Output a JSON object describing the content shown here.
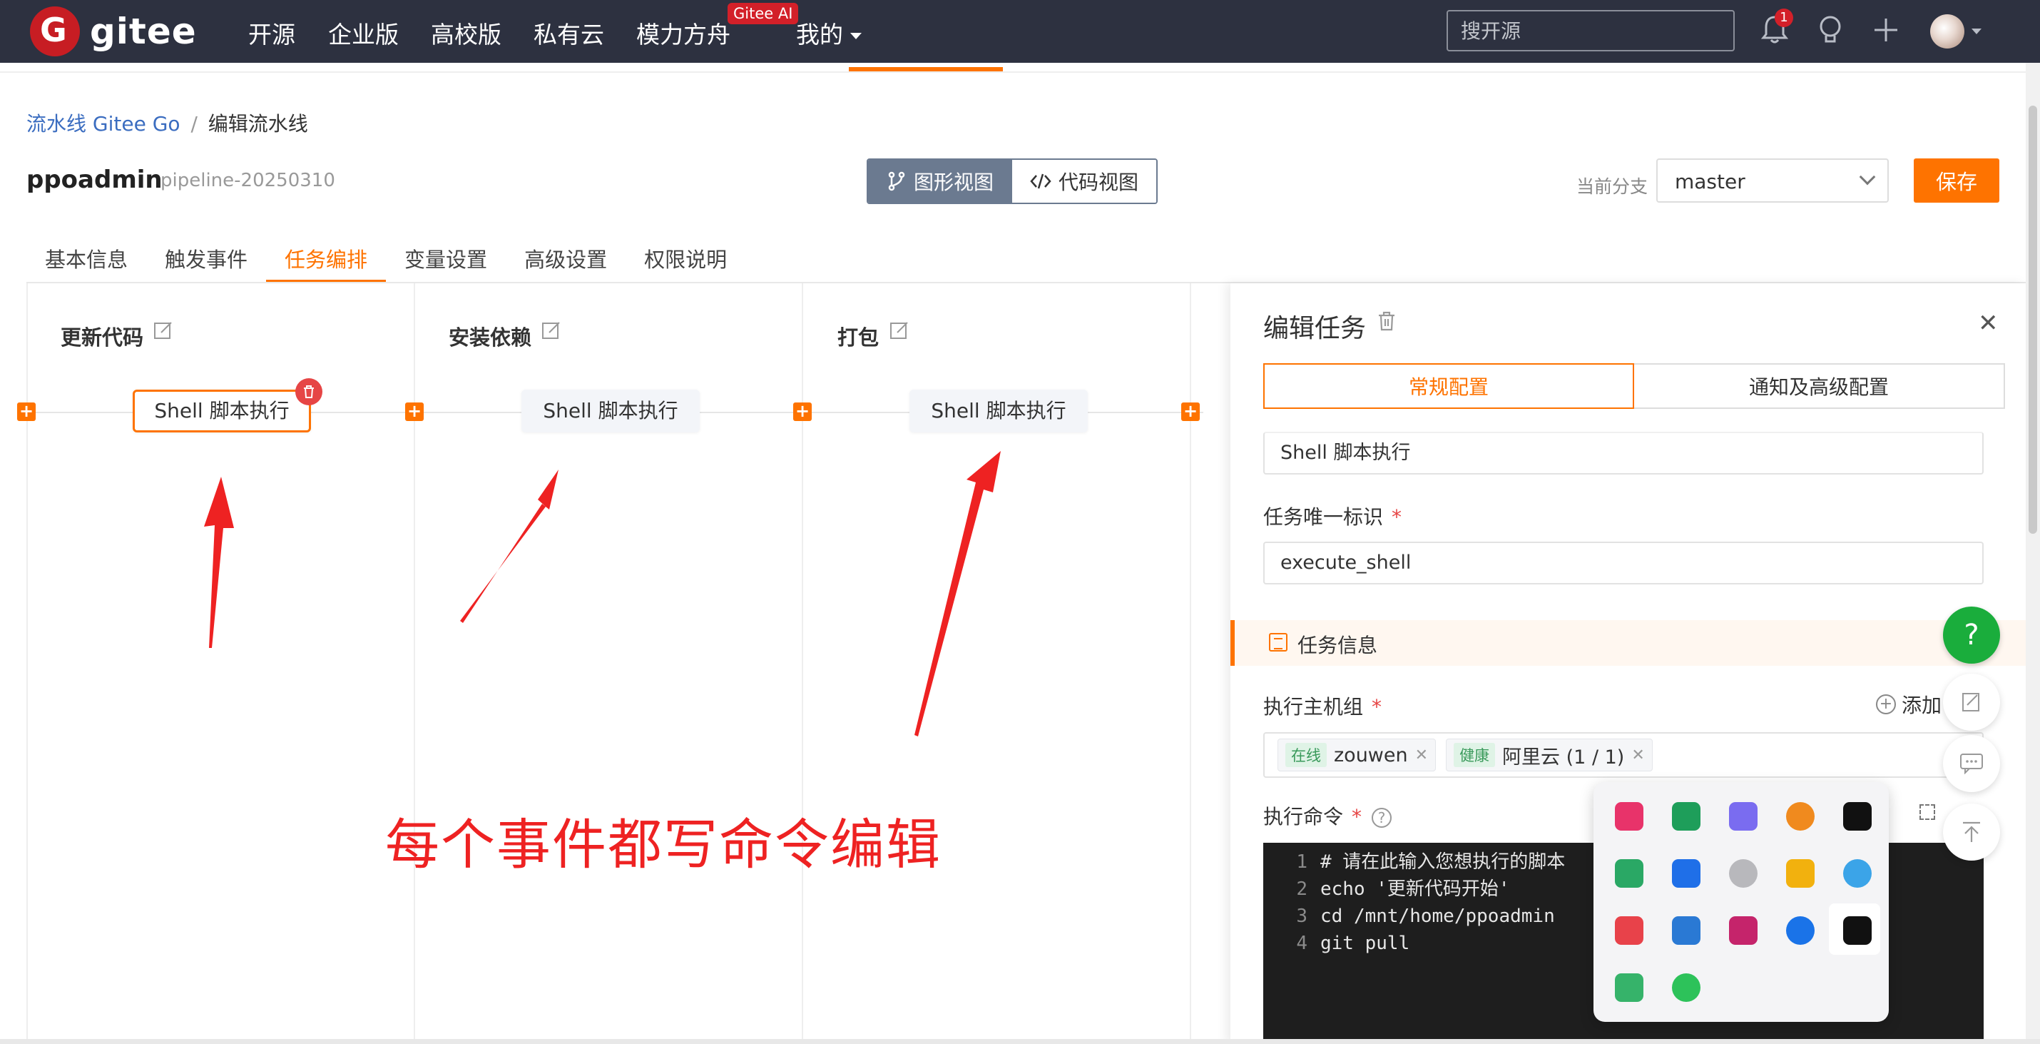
{
  "nav": {
    "brand": "gitee",
    "items": [
      "开源",
      "企业版",
      "高校版",
      "私有云",
      "模力方舟",
      "我的"
    ],
    "ai_badge": "Gitee AI",
    "search_placeholder": "搜开源",
    "notification_count": "1"
  },
  "breadcrumb": {
    "parent": "流水线 Gitee Go",
    "separator": "/",
    "current": "编辑流水线"
  },
  "header": {
    "project": "ppoadmin",
    "pipeline": "pipeline-20250310",
    "view_graph": "图形视图",
    "view_code": "代码视图",
    "branch_label": "当前分支",
    "branch_value": "master",
    "save": "保存"
  },
  "tabs": [
    "基本信息",
    "触发事件",
    "任务编排",
    "变量设置",
    "高级设置",
    "权限说明"
  ],
  "active_tab": "任务编排",
  "stages": [
    {
      "title": "更新代码",
      "job": "Shell 脚本执行"
    },
    {
      "title": "安装依赖",
      "job": "Shell 脚本执行"
    },
    {
      "title": "打包",
      "job": "Shell 脚本执行"
    }
  ],
  "annotation": "每个事件都写命令编辑",
  "drawer": {
    "title": "编辑任务",
    "tab_general": "常规配置",
    "tab_advanced": "通知及高级配置",
    "task_name_value": "Shell 脚本执行",
    "task_id_label": "任务唯一标识",
    "task_id_value": "execute_shell",
    "section_title": "任务信息",
    "host_group_label": "执行主机组",
    "add_label": "添加",
    "hosts": [
      {
        "status": "在线",
        "name": "zouwen"
      },
      {
        "status": "健康",
        "name": "阿里云 (1 / 1)"
      }
    ],
    "command_label": "执行命令",
    "required_mark": "*",
    "code_lines": [
      "# 请在此输入您想执行的脚本",
      "echo '更新代码开始'",
      "cd /mnt/home/ppoadmin",
      "git pull"
    ]
  },
  "colors": {
    "accent": "#fe7300",
    "nav_bg": "#2d3140",
    "help_green": "#1aad3c",
    "annotation_red": "#ee2222"
  }
}
